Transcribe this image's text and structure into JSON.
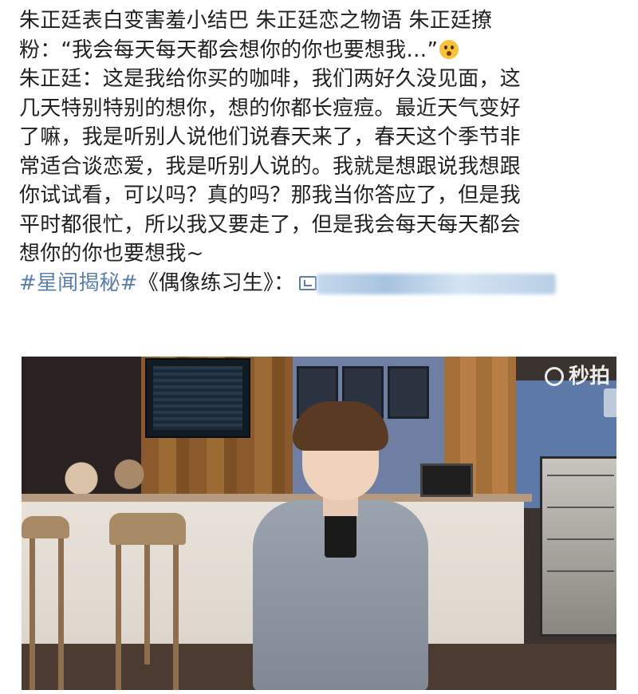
{
  "post": {
    "lines": [
      "朱正廷表白变害羞小结巴 朱正廷恋之物语 朱正廷撩",
      "粉：“我会每天每天都会想你的你也要想我…”"
    ],
    "body": [
      "朱正廷：这是我给你买的咖啡，我们两好久没见面，这",
      "几天特别特别的想你，想的你都长痘痘。最近天气变好",
      "了嘛，我是听别人说他们说春天来了，春天这个季节非",
      "常适合谈恋爱，我是听别人说的。我就是想跟说我想跟",
      "你试试看，可以吗？真的吗？那我当你答应了，但是我",
      "平时都很忙，所以我又要走了，但是我会每天每天都会",
      "想你的你也要想我~"
    ],
    "topic_tag": "#星闻揭秘#",
    "show_title": "《偶像练习生》：",
    "emoji_icon": "scream-emoji-icon"
  },
  "video": {
    "watermark": "秒拍",
    "icons": [
      "miaopai-logo-icon"
    ]
  },
  "colors": {
    "text": "#222222",
    "topic": "#5b7fae",
    "background": "#ffffff"
  }
}
